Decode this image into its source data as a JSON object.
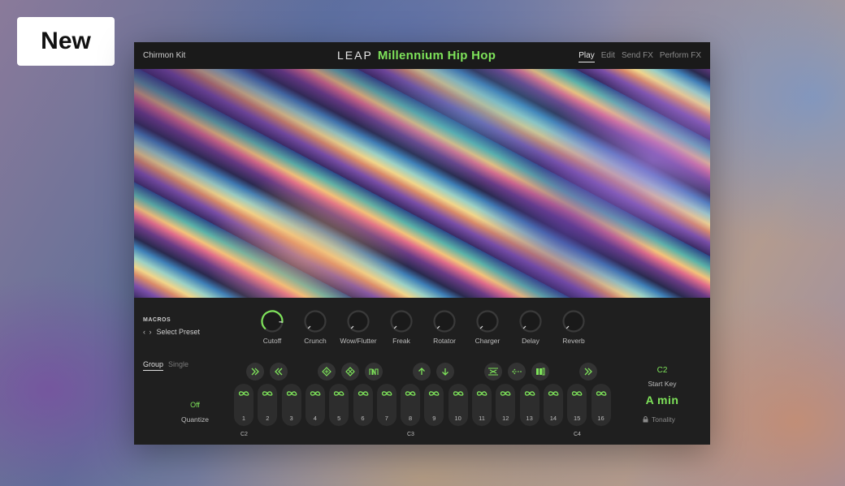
{
  "badge": {
    "label": "New"
  },
  "header": {
    "kit_name": "Chirmon Kit",
    "brand_leap": "LEAP",
    "brand_title": "Millennium Hip Hop",
    "tabs": [
      {
        "label": "Play",
        "active": true
      },
      {
        "label": "Edit",
        "active": false
      },
      {
        "label": "Send FX",
        "active": false
      },
      {
        "label": "Perform FX",
        "active": false
      }
    ]
  },
  "macros": {
    "title": "MACROS",
    "preset_label": "Select Preset",
    "knobs": [
      {
        "label": "Cutoff",
        "value": 0.85
      },
      {
        "label": "Crunch",
        "value": 0.0
      },
      {
        "label": "Wow/Flutter",
        "value": 0.0
      },
      {
        "label": "Freak",
        "value": 0.0
      },
      {
        "label": "Rotator",
        "value": 0.0
      },
      {
        "label": "Charger",
        "value": 0.0
      },
      {
        "label": "Delay",
        "value": 0.0
      },
      {
        "label": "Reverb",
        "value": 0.0
      }
    ]
  },
  "mode": {
    "group": "Group",
    "single": "Single"
  },
  "quantize": {
    "value": "Off",
    "label": "Quantize"
  },
  "slots": [
    {
      "num": "1"
    },
    {
      "num": "2"
    },
    {
      "num": "3"
    },
    {
      "num": "4"
    },
    {
      "num": "5"
    },
    {
      "num": "6"
    },
    {
      "num": "7"
    },
    {
      "num": "8"
    },
    {
      "num": "9"
    },
    {
      "num": "10"
    },
    {
      "num": "11"
    },
    {
      "num": "12"
    },
    {
      "num": "13"
    },
    {
      "num": "14"
    },
    {
      "num": "15"
    },
    {
      "num": "16"
    }
  ],
  "octaves": [
    "C2",
    "C3",
    "C4"
  ],
  "start_key": {
    "value": "C2",
    "label": "Start Key"
  },
  "tonality": {
    "value": "A  min",
    "label": "Tonality"
  },
  "colors": {
    "accent": "#7ee35a",
    "panel": "#1f1f1f",
    "slot": "#2d2d2d"
  }
}
